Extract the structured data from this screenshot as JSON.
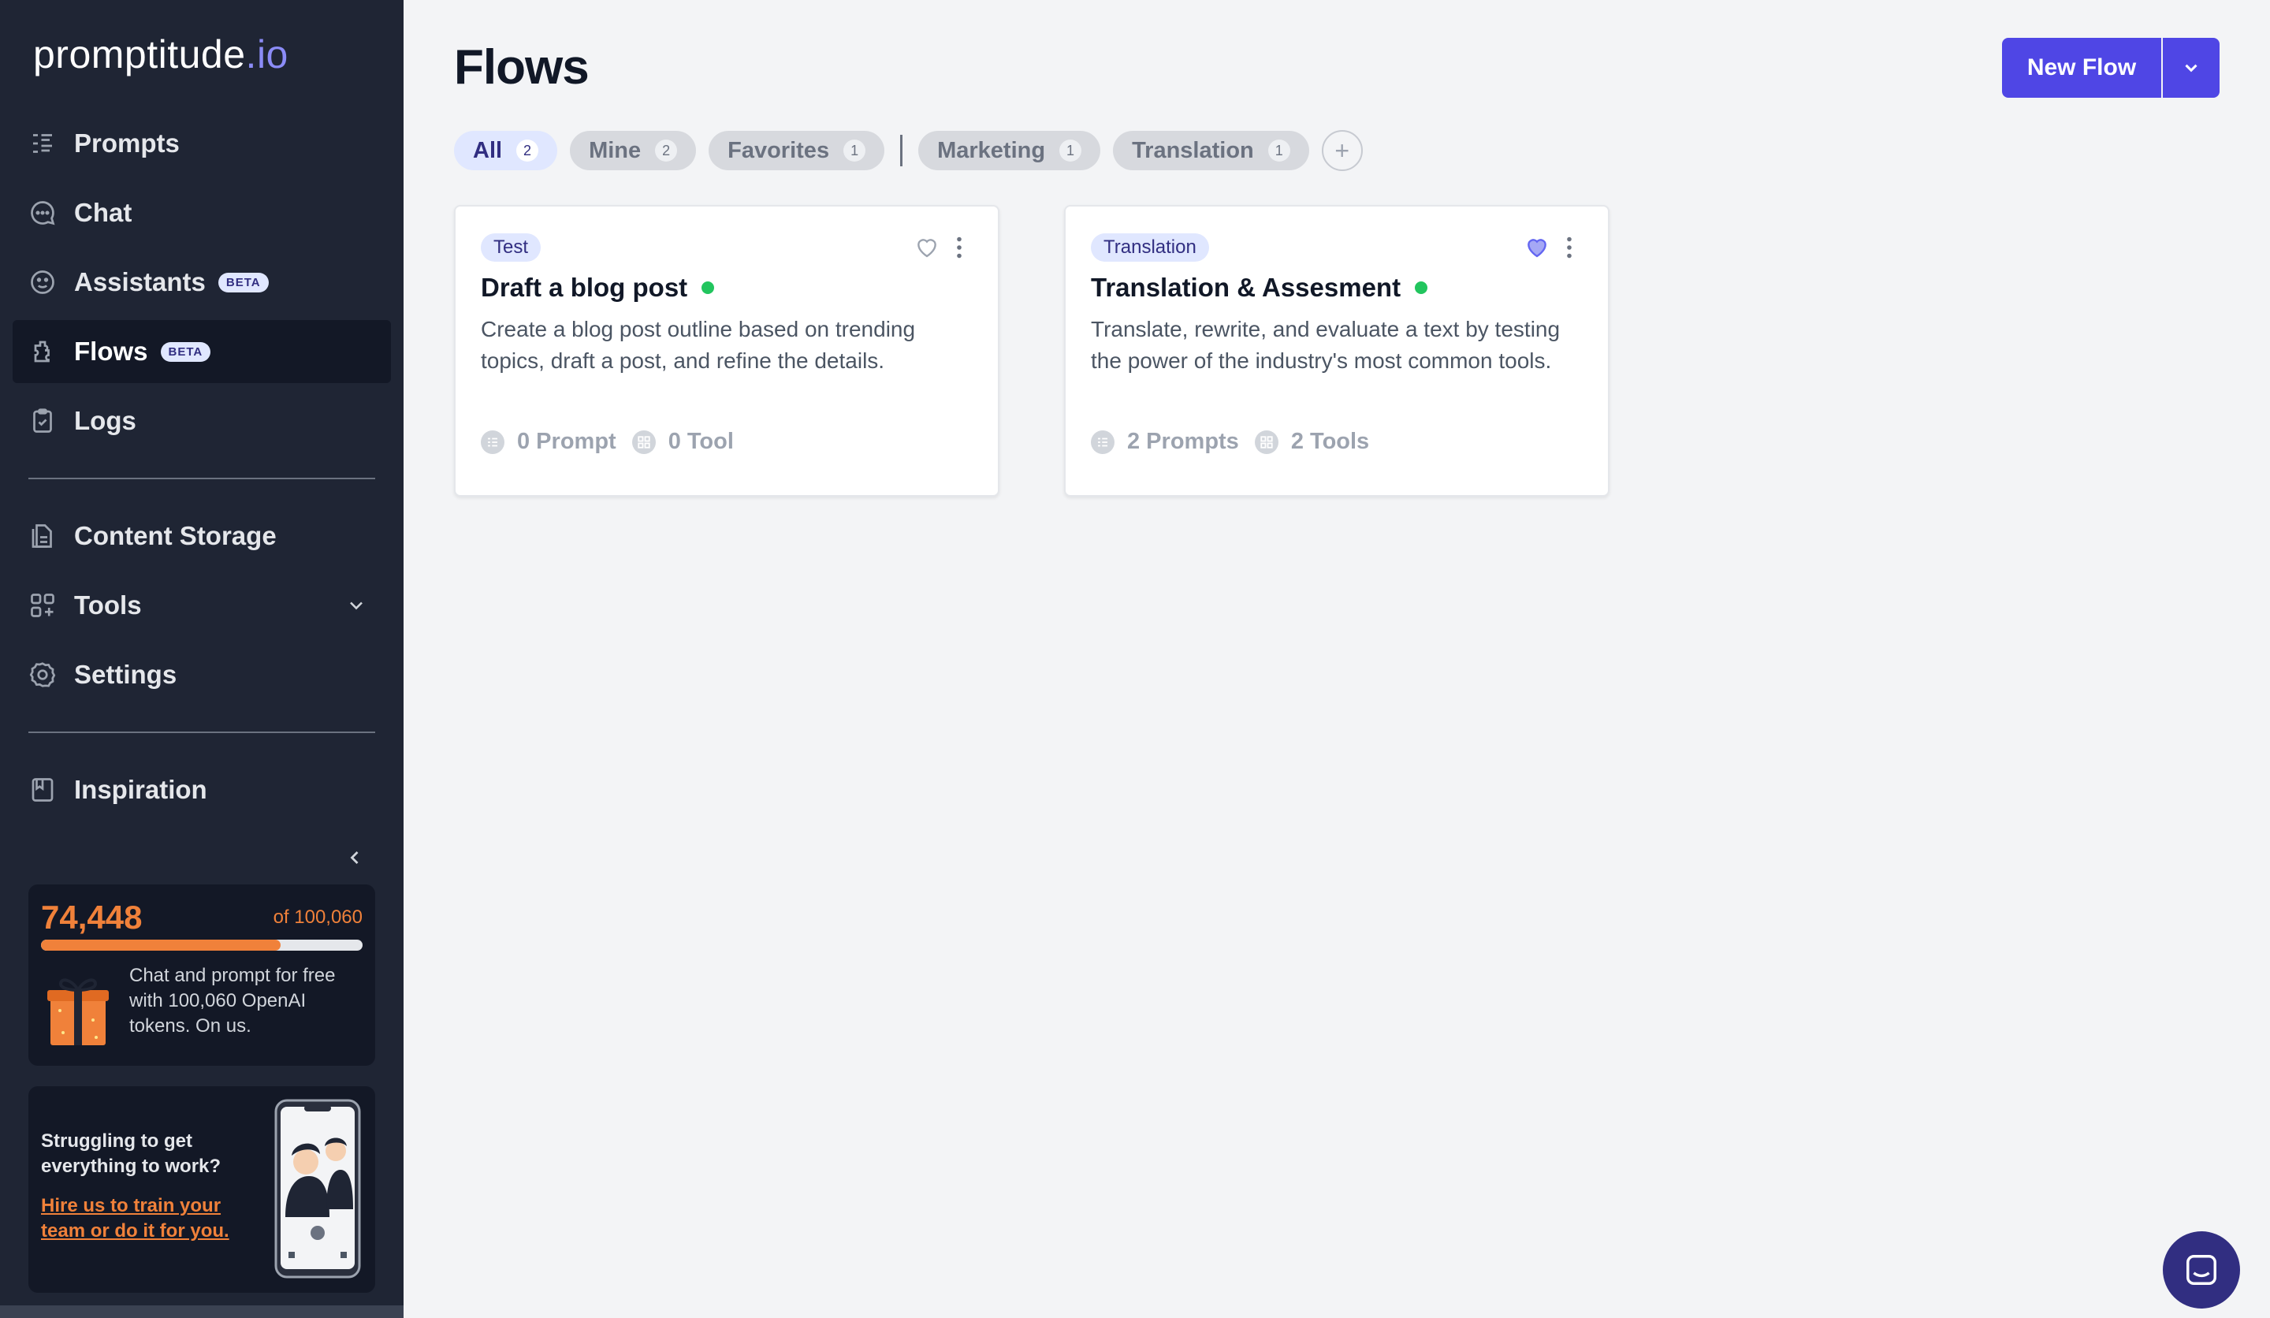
{
  "brand": {
    "logo_main": "promptitude",
    "logo_suffix": ".io",
    "accent": "#4f46e5",
    "token_color": "#f0813a"
  },
  "sidebar": {
    "items": [
      {
        "label": "Prompts",
        "icon": "prompts-icon"
      },
      {
        "label": "Chat",
        "icon": "chat-icon"
      },
      {
        "label": "Assistants",
        "icon": "assistants-icon",
        "badge": "BETA"
      },
      {
        "label": "Flows",
        "icon": "flows-icon",
        "badge": "BETA",
        "active": true
      },
      {
        "label": "Logs",
        "icon": "clipboard-icon"
      },
      {
        "label": "Content Storage",
        "icon": "documents-icon"
      },
      {
        "label": "Tools",
        "icon": "tools-icon",
        "expandable": true
      },
      {
        "label": "Settings",
        "icon": "gear-icon"
      },
      {
        "label": "Inspiration",
        "icon": "book-icon"
      }
    ],
    "tokens": {
      "used": "74,448",
      "total": "of 100,060",
      "fill_fraction": 0.744,
      "description": "Chat and prompt for free with 100,060 OpenAI tokens. On us."
    },
    "hire": {
      "title": "Struggling to get everything to work?",
      "link": "Hire us to train your team or do it for you."
    }
  },
  "main": {
    "title": "Flows",
    "new_button": "New Flow",
    "filters": [
      {
        "label": "All",
        "count": "2",
        "active": true
      },
      {
        "label": "Mine",
        "count": "2"
      },
      {
        "label": "Favorites",
        "count": "1"
      },
      {
        "label": "Marketing",
        "count": "1"
      },
      {
        "label": "Translation",
        "count": "1"
      }
    ],
    "add_filter": "+",
    "cards": [
      {
        "tag": "Test",
        "title": "Draft a blog post",
        "description": "Create a blog post outline based on trending topics, draft a post, and refine the details.",
        "prompts": "0 Prompt",
        "tools": "0 Tool",
        "favorite": false
      },
      {
        "tag": "Translation",
        "title": "Translation & Assesment",
        "description": "Translate, rewrite, and evaluate a text by testing the power of the industry's most common tools.",
        "prompts": "2 Prompts",
        "tools": "2 Tools",
        "favorite": true
      }
    ]
  }
}
